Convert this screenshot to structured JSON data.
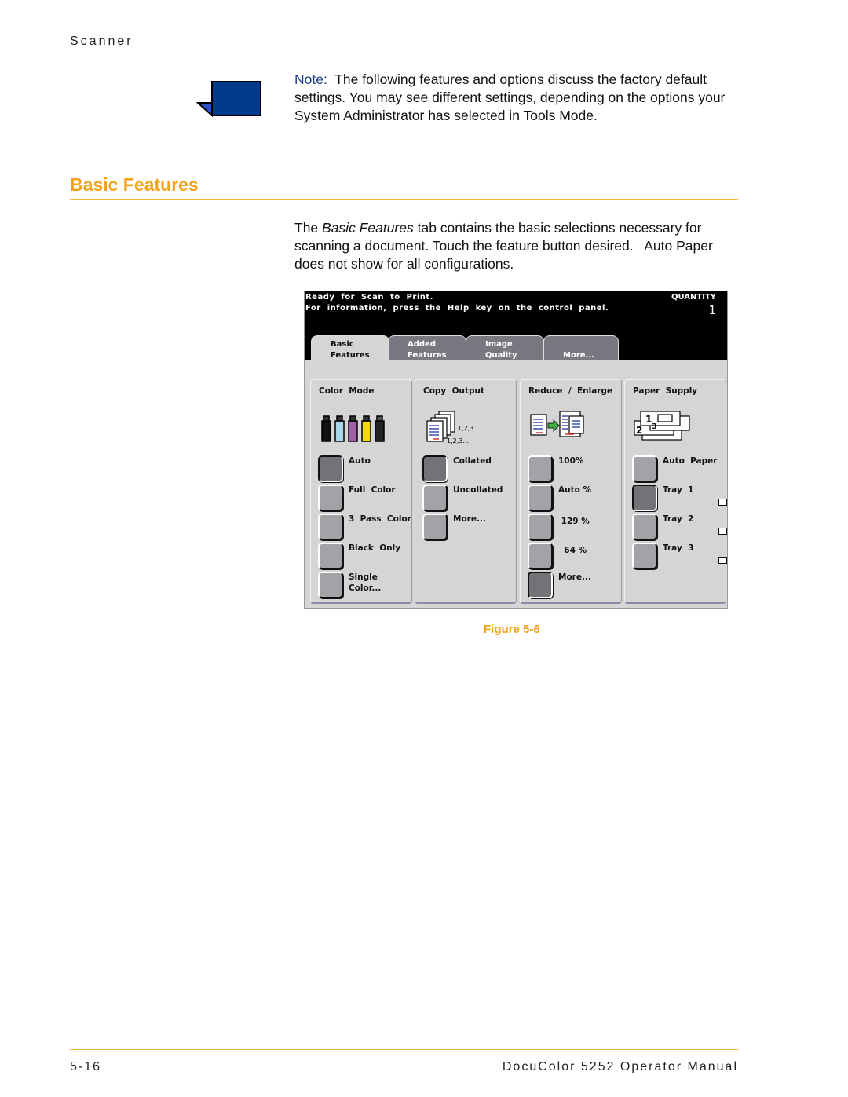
{
  "header": {
    "section": "Scanner"
  },
  "note": {
    "icon": "note-page-icon",
    "label": "Note:",
    "text": "  The following features and options discuss the factory default settings. You may see different settings, depending on the options your System Administrator has selected in Tools Mode."
  },
  "section_title": "Basic Features",
  "body": {
    "pre": "The ",
    "emph": "Basic Features",
    "post": " tab contains the basic selections necessary for scanning a document. Touch the feature button desired.   Auto Paper does not show for all configurations."
  },
  "screen": {
    "status_line1": "Ready  for  Scan  to  Print.",
    "status_line2": "For  information,  press  the  Help  key  on  the  control  panel.",
    "quantity_label": "QUANTITY",
    "quantity_value": "1",
    "tabs": [
      {
        "line1": "Basic",
        "line2": "Features",
        "active": true
      },
      {
        "line1": "Added",
        "line2": "Features",
        "active": false
      },
      {
        "line1": "Image",
        "line2": "Quality",
        "active": false
      },
      {
        "line1": "",
        "line2": "More...",
        "active": false
      }
    ],
    "panels": [
      {
        "title": "Color  Mode",
        "graphic": "toner-bottles-icon",
        "options": [
          {
            "label": "Auto",
            "selected": true
          },
          {
            "label": "Full  Color",
            "selected": false
          },
          {
            "label": "3  Pass  Color",
            "selected": false
          },
          {
            "label": "Black  Only",
            "selected": false
          },
          {
            "label": "Single\nColor...",
            "selected": false
          }
        ]
      },
      {
        "title": "Copy  Output",
        "graphic": "collated-pages-icon",
        "graphic_text1": "1,2,3...",
        "graphic_text2": "1,2,3...",
        "options": [
          {
            "label": "Collated",
            "selected": true
          },
          {
            "label": "Uncollated",
            "selected": false
          },
          {
            "label": "More...",
            "selected": false
          }
        ]
      },
      {
        "title": "Reduce  /  Enlarge",
        "graphic": "reduce-enlarge-icon",
        "options": [
          {
            "label": "100%",
            "selected": false
          },
          {
            "label": "Auto %",
            "selected": false
          },
          {
            "label": " 129 %",
            "selected": false
          },
          {
            "label": "  64 %",
            "selected": false
          },
          {
            "label": "More...",
            "selected": true
          }
        ]
      },
      {
        "title": "Paper  Supply",
        "graphic": "paper-trays-icon",
        "graphic_text1": "1",
        "graphic_text2": "2",
        "graphic_text3": "3",
        "options": [
          {
            "label": "Auto  Paper",
            "selected": false
          },
          {
            "label": "Tray  1",
            "selected": true
          },
          {
            "label": "Tray  2",
            "selected": false
          },
          {
            "label": "Tray  3",
            "selected": false
          }
        ]
      }
    ]
  },
  "figure_caption": "Figure 5-6",
  "footer": {
    "page": "5-16",
    "manual": "DocuColor 5252 Operator Manual"
  },
  "colors": {
    "accent": "#f5a21a",
    "rule": "#f4b63a",
    "note_blue": "#1a3f8a",
    "icon_blue": "#003a8c"
  }
}
